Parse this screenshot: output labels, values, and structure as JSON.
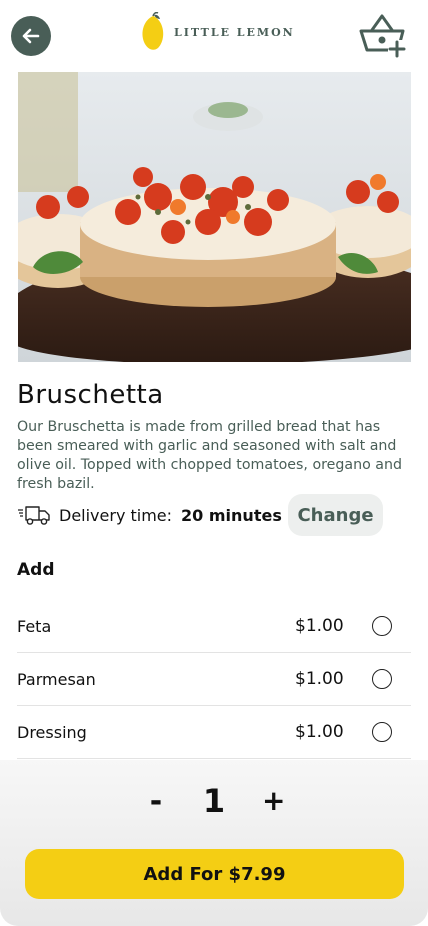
{
  "header": {
    "back_icon": "arrow-left-icon",
    "logo_text": "LITTLE LEMON",
    "basket_icon": "basket-add-icon"
  },
  "dish": {
    "title": "Bruschetta",
    "description": "Our Bruschetta is made from grilled bread that has been smeared with garlic and seasoned with salt and olive oil. Topped with chopped tomatoes, oregano and fresh bazil."
  },
  "delivery": {
    "icon": "delivery-truck-icon",
    "label": "Delivery time:",
    "value": "20 minutes",
    "change_label": "Change"
  },
  "add_section": {
    "heading": "Add",
    "options": [
      {
        "name": "Feta",
        "price": "$1.00"
      },
      {
        "name": "Parmesan",
        "price": "$1.00"
      },
      {
        "name": "Dressing",
        "price": "$1.00"
      }
    ]
  },
  "quantity": {
    "minus": "-",
    "value": "1",
    "plus": "+"
  },
  "cta": {
    "label": "Add For $7.99"
  },
  "colors": {
    "primary_green": "#495e57",
    "primary_yellow": "#f4ce14",
    "light_gray": "#edefee"
  }
}
